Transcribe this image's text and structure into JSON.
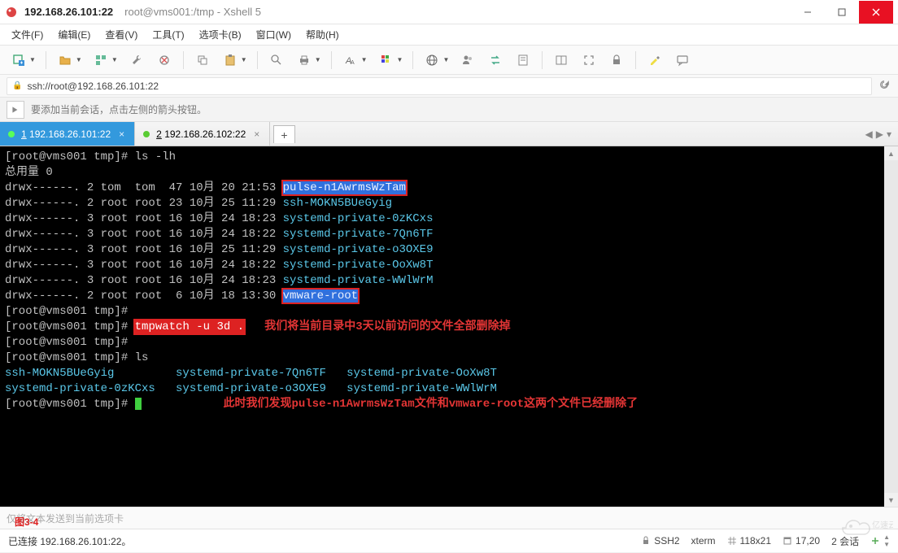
{
  "window": {
    "title_primary": "192.168.26.101:22",
    "title_secondary": "root@vms001:/tmp - Xshell 5"
  },
  "menu": {
    "file": "文件(F)",
    "edit": "编辑(E)",
    "view": "查看(V)",
    "tools": "工具(T)",
    "tabs": "选项卡(B)",
    "window": "窗口(W)",
    "help": "帮助(H)"
  },
  "address": {
    "url": "ssh://root@192.168.26.101:22"
  },
  "hint": {
    "text": "要添加当前会话，点击左侧的箭头按钮。"
  },
  "tabs": [
    {
      "num": "1",
      "label": "192.168.26.101:22",
      "active": true
    },
    {
      "num": "2",
      "label": "192.168.26.102:22",
      "active": false
    }
  ],
  "terminal": {
    "prompt": "[root@vms001 tmp]#",
    "cmd_ls_lh": "ls -lh",
    "total": "总用量 0",
    "rows": [
      {
        "perm": "drwx------. 2 tom  tom  47 10月 20 21:53 ",
        "name": "pulse-n1AwrmsWzTam",
        "hl": true
      },
      {
        "perm": "drwx------. 2 root root 23 10月 25 11:29 ",
        "name": "ssh-MOKN5BUeGyig",
        "hl": false
      },
      {
        "perm": "drwx------. 3 root root 16 10月 24 18:23 ",
        "name": "systemd-private-0zKCxs",
        "hl": false
      },
      {
        "perm": "drwx------. 3 root root 16 10月 24 18:22 ",
        "name": "systemd-private-7Qn6TF",
        "hl": false
      },
      {
        "perm": "drwx------. 3 root root 16 10月 25 11:29 ",
        "name": "systemd-private-o3OXE9",
        "hl": false
      },
      {
        "perm": "drwx------. 3 root root 16 10月 24 18:22 ",
        "name": "systemd-private-OoXw8T",
        "hl": false
      },
      {
        "perm": "drwx------. 3 root root 16 10月 24 18:23 ",
        "name": "systemd-private-WWlWrM",
        "hl": false
      },
      {
        "perm": "drwx------. 2 root root  6 10月 18 13:30 ",
        "name": "vmware-root",
        "hl": true
      }
    ],
    "cmd_tmpwatch": "tmpwatch -u 3d .",
    "annotation1": "我们将当前目录中3天以前访问的文件全部删除掉",
    "cmd_ls": "ls",
    "lscols": {
      "l1a": "ssh-MOKN5BUeGyig",
      "l1b": "systemd-private-7Qn6TF",
      "l1c": "systemd-private-OoXw8T",
      "l2a": "systemd-private-0zKCxs",
      "l2b": "systemd-private-o3OXE9",
      "l2c": "systemd-private-WWlWrM"
    },
    "annotation2": "此时我们发现pulse-n1AwrmsWzTam文件和vmware-root这两个文件已经删除了"
  },
  "figure_label": "图3-4",
  "input_placeholder": "仅将文本发送到当前选项卡",
  "status": {
    "connected": "已连接 192.168.26.101:22。",
    "proto": "SSH2",
    "emul": "xterm",
    "size": "118x21",
    "pos": "17,20",
    "sessions": "2 会话"
  },
  "watermark_text": "亿速云"
}
